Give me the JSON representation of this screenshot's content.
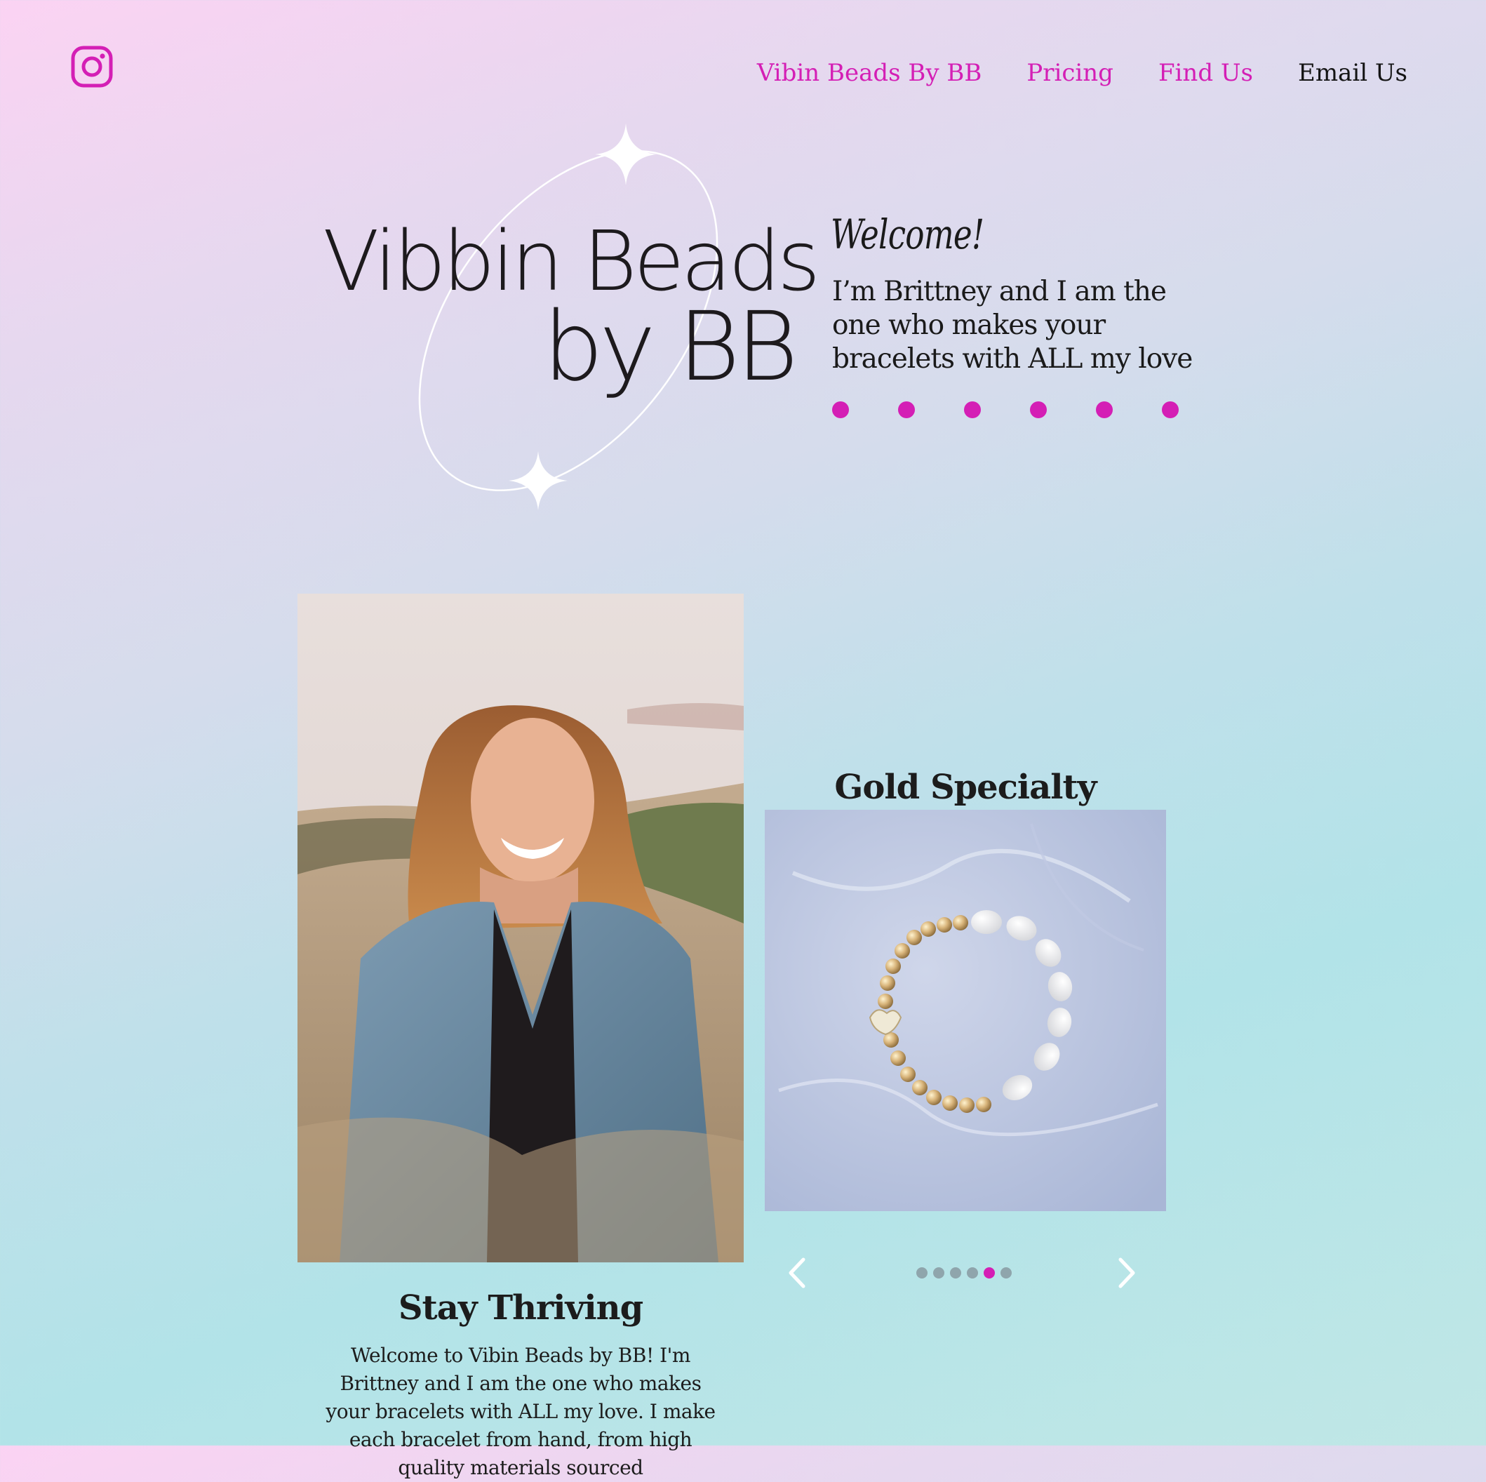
{
  "header": {
    "social_icon": "instagram-icon",
    "nav": [
      {
        "label": "Vibin Beads By BB",
        "active": false
      },
      {
        "label": "Pricing",
        "active": false
      },
      {
        "label": "Find Us",
        "active": false
      },
      {
        "label": "Email Us",
        "active": true
      }
    ]
  },
  "hero": {
    "logo_line1": "Vibbin Beads",
    "logo_line2": "by BB",
    "welcome_title": "Welcome!",
    "welcome_text": "I’m Brittney and I am the one who makes your bracelets with ALL my love",
    "decorative_dots": 6
  },
  "about": {
    "title": "Stay Thriving",
    "body": "Welcome to Vibin Beads by BB! I'm Brittney and I am the one who makes your bracelets with ALL my love. I make each bracelet from hand, from high quality materials sourced"
  },
  "gallery": {
    "slide_title": "Gold Specialty",
    "slide_count": 6,
    "current_slide": 5,
    "prev_icon": "chevron-left-icon",
    "next_icon": "chevron-right-icon"
  },
  "colors": {
    "accent": "#d41fb5",
    "text": "#1a1a1a",
    "pager_inactive": "#8fa5ac",
    "background_top_left": "#fbd3f3",
    "background_bottom_right": "#c0e7e6"
  }
}
